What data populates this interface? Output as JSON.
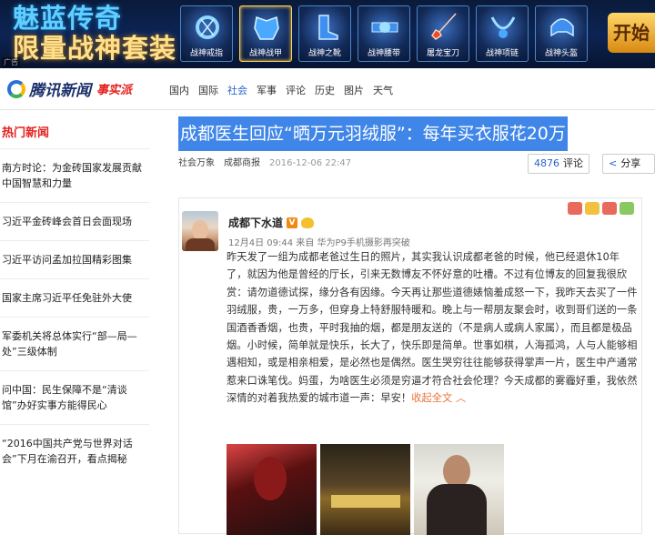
{
  "ad": {
    "title_line1": "魅蓝传奇",
    "title_line2": "限量战神套装",
    "items": [
      "战神戒指",
      "战神战甲",
      "战神之靴",
      "战神腰带",
      "屠龙宝刀",
      "战神项链",
      "战神头盔"
    ],
    "cta": "开始",
    "tag": "广告"
  },
  "header": {
    "logo_text": "腾讯新闻",
    "logo_sub": "事实派",
    "nav": [
      "国内",
      "国际",
      "社会",
      "军事",
      "评论",
      "历史",
      "图片",
      "天气"
    ],
    "active_nav": "社会"
  },
  "sidebar": {
    "heading": "热门新闻",
    "items": [
      "南方时论：为金砖国家发展贡献中国智慧和力量",
      "习近平金砖峰会首日会面现场",
      "习近平访问孟加拉国精彩图集",
      "国家主席习近平任免驻外大使",
      "军委机关将总体实行“部—局—处”三级体制",
      "问中国：民生保障不是“清谈馆”办好实事方能得民心",
      "“2016中国共产党与世界对话会”下月在渝召开，看点揭秘"
    ]
  },
  "article": {
    "title": "成都医生回应“晒万元羽绒服”：每年买衣服花20万",
    "source1": "社会万象",
    "source2": "成都商报",
    "time": "2016-12-06 22:47",
    "comment_count": "4876",
    "comment_label": "评论",
    "share_label": "分享"
  },
  "post": {
    "username": "成都下水道",
    "meta": "12月4日 09:44 来自 华为P9手机摄影再突破",
    "text": "昨天发了一组为成都老爸过生日的照片，其实我认识成都老爸的时候，他已经退休10年了，就因为他是曾经的厅长，引来无数博友不怀好意的吐槽。不过有位博友的回复我很欣赏：请勿道德试探，缘分各有因缘。今天再让那些道德婊恼羞成怒一下，我昨天去买了一件羽绒服，贵，一万多，但穿身上特舒服特暖和。晚上与一帮朋友聚会时，收到哥们送的一条国酒香香烟，也贵，平时我抽的烟，都是朋友送的（不是病人或病人家属），而且都是极品烟。小时候，简单就是快乐，长大了，快乐即是简单。世事如棋，人海孤鸿，人与人能够相遇相知，或是相亲相爱，是必然也是偶然。医生哭穷往往能够获得掌声一片，医生中产通常惹来口诛笔伐。妈蛋，为啥医生必须是穷逼才符合社会伦理？今天成都的雾霾好重，我依然深情的对着我热爱的城市道一声：早安！",
    "fold_label": "收起全文 ︿"
  },
  "colors": {
    "headline_bg": "#3f86e8",
    "sidebar_heading": "#e3211e",
    "accent_blue": "#2a64c8",
    "fold_orange": "#e8743c"
  }
}
